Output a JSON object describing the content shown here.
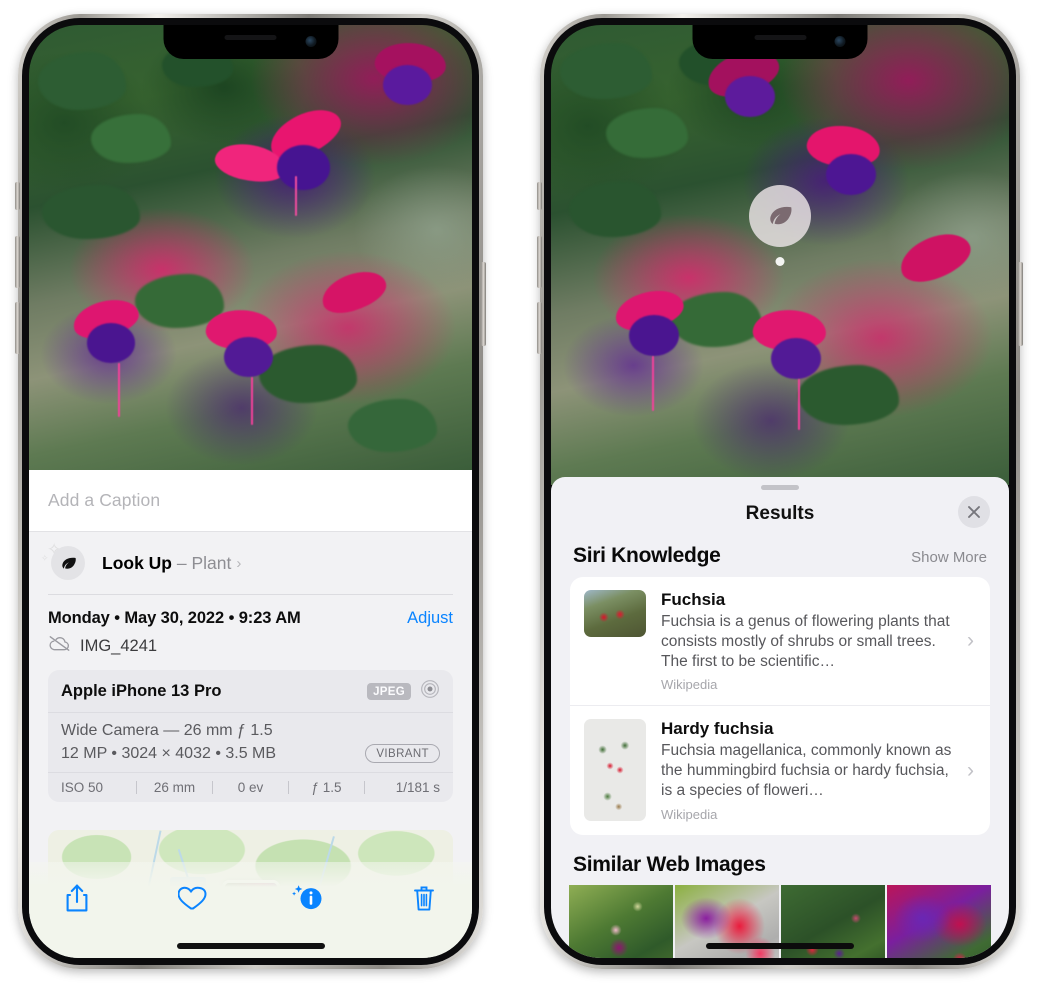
{
  "left_phone": {
    "name": "photo-info-screen",
    "caption_field": {
      "placeholder": "Add a Caption",
      "value": ""
    },
    "lookup_row": {
      "icon": "leaf-icon",
      "sparkle_icon": "sparkles-icon",
      "label": "Look Up",
      "separator": "–",
      "subject": "Plant",
      "chevron": "›"
    },
    "date_row": {
      "date_text": "Monday • May 30, 2022 • 9:23 AM",
      "adjust_label": "Adjust"
    },
    "file_row": {
      "icon": "cloud-slash-icon",
      "file_name": "IMG_4241"
    },
    "exif": {
      "device": "Apple iPhone 13 Pro",
      "format_badge": "JPEG",
      "lens_icon": "aperture-icon",
      "lens_line": "Wide Camera — 26 mm ƒ 1.5",
      "size_line": "12 MP • 3024 × 4032 • 3.5 MB",
      "style_badge": "VIBRANT",
      "stats": [
        "ISO 50",
        "26 mm",
        "0 ev",
        "ƒ 1.5",
        "1/181 s"
      ]
    },
    "map": {
      "name": "location-map-thumbnail"
    },
    "toolbar": [
      {
        "name": "share-button",
        "icon": "share-icon"
      },
      {
        "name": "favorite-button",
        "icon": "heart-icon"
      },
      {
        "name": "info-button",
        "icon": "info-sparkle-icon"
      },
      {
        "name": "delete-button",
        "icon": "trash-icon"
      }
    ]
  },
  "right_phone": {
    "name": "visual-lookup-results-screen",
    "photo_badge": {
      "icon": "leaf-icon",
      "name": "visual-lookup-badge"
    },
    "sheet": {
      "title": "Results",
      "close_icon": "close-icon",
      "siri_knowledge": {
        "title": "Siri Knowledge",
        "action": "Show More",
        "items": [
          {
            "title": "Fuchsia",
            "description": "Fuchsia is a genus of flowering plants that consists mostly of shrubs or small trees. The first to be scientific…",
            "source": "Wikipedia",
            "chevron": "›"
          },
          {
            "title": "Hardy fuchsia",
            "description": "Fuchsia magellanica, commonly known as the hummingbird fuchsia or hardy fuchsia, is a species of floweri…",
            "source": "Wikipedia",
            "chevron": "›"
          }
        ]
      },
      "similar_web_images": {
        "title": "Similar Web Images",
        "items": [
          {
            "name": "web-image-1"
          },
          {
            "name": "web-image-2"
          },
          {
            "name": "web-image-3"
          },
          {
            "name": "web-image-4"
          }
        ]
      }
    }
  },
  "colors": {
    "accent_blue": "#0a84ff",
    "sheet_bg": "#f1f1f5",
    "card_white": "#ffffff",
    "secondary_text": "#8e8e93"
  }
}
